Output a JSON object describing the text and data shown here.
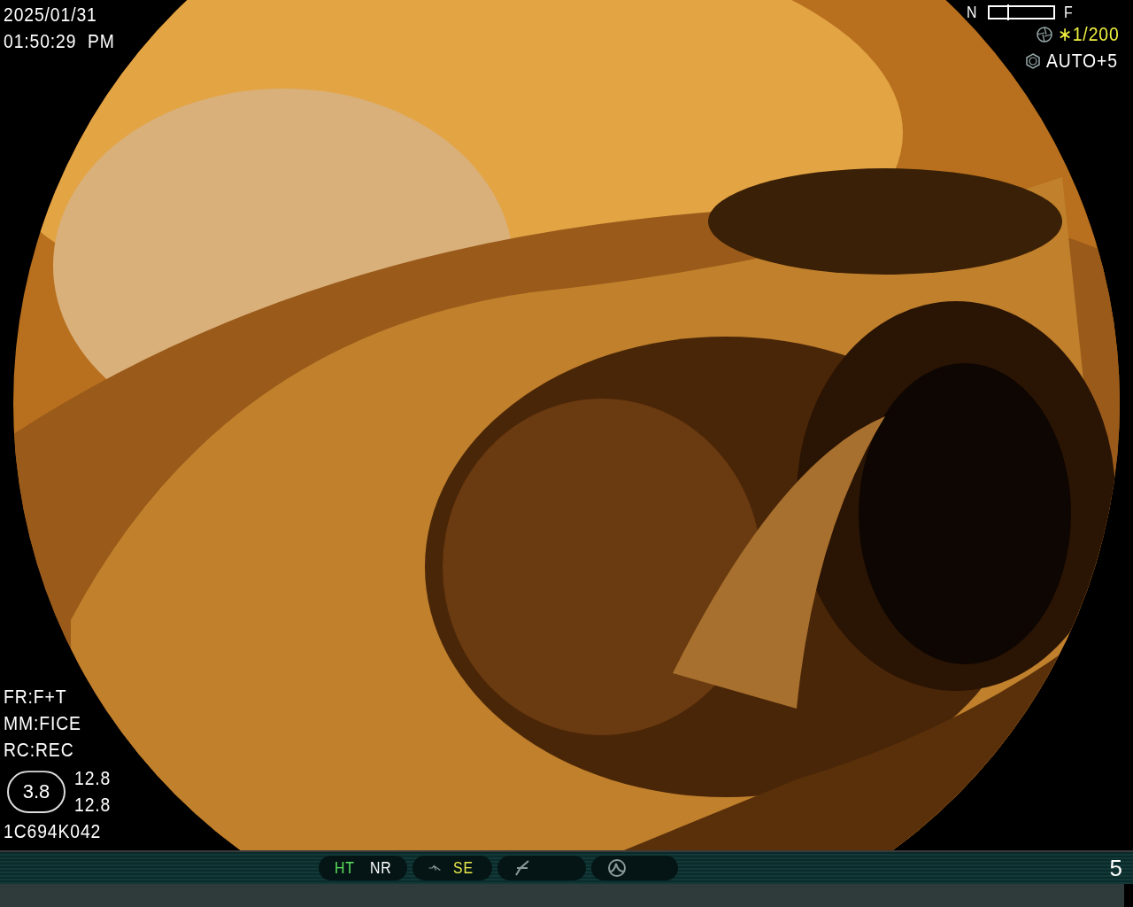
{
  "date": "2025/01/31",
  "time": "01:50:29  PM",
  "focus": {
    "near": "N",
    "far": "F",
    "level": 0.28
  },
  "shutter": {
    "value": "∗1/200"
  },
  "iris": {
    "value": "AUTO+5"
  },
  "settings": [
    "FR:F+T",
    "MM:FICE",
    "RC:REC"
  ],
  "zoom_badge": "3.8",
  "readings": [
    "12.8",
    "12.8"
  ],
  "scope_id": "1C694K042",
  "status_groups": [
    {
      "kind": "text",
      "items": [
        {
          "label": "HT",
          "color": "#5ee05e"
        },
        {
          "label": "NR",
          "color": "#ffffff"
        }
      ]
    },
    {
      "kind": "curve",
      "items": [
        {
          "label": "SE",
          "color": "#e8e84a"
        }
      ]
    },
    {
      "kind": "slope"
    },
    {
      "kind": "peak"
    }
  ],
  "page_number": "5"
}
